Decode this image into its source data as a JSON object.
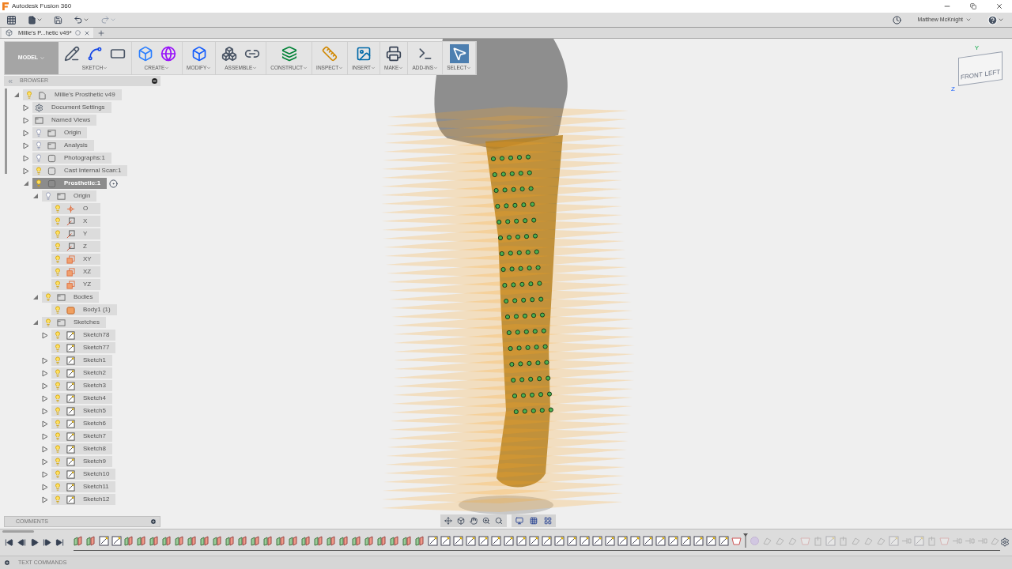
{
  "window": {
    "title": "Autodesk Fusion 360",
    "user": "Matthew McKnight"
  },
  "document_tab": {
    "title": "Millie's P...hetic v49*"
  },
  "ribbon": {
    "workspace": "MODEL",
    "groups": [
      {
        "label": "SKETCH",
        "tools": [
          {
            "kind": "sketch"
          },
          {
            "kind": "arc"
          },
          {
            "kind": "rectangle"
          }
        ],
        "selected": false
      },
      {
        "label": "CREATE",
        "tools": [
          {
            "kind": "box"
          },
          {
            "kind": "form"
          }
        ],
        "selected": false
      },
      {
        "label": "MODIFY",
        "tools": [
          {
            "kind": "press-pull"
          }
        ],
        "selected": false
      },
      {
        "label": "ASSEMBLE",
        "tools": [
          {
            "kind": "component"
          },
          {
            "kind": "joint"
          }
        ],
        "selected": false
      },
      {
        "label": "CONSTRUCT",
        "tools": [
          {
            "kind": "plane"
          }
        ],
        "selected": false
      },
      {
        "label": "INSPECT",
        "tools": [
          {
            "kind": "measure"
          }
        ],
        "selected": false
      },
      {
        "label": "INSERT",
        "tools": [
          {
            "kind": "image"
          }
        ],
        "selected": false
      },
      {
        "label": "MAKE",
        "tools": [
          {
            "kind": "print"
          }
        ],
        "selected": false
      },
      {
        "label": "ADD-INS",
        "tools": [
          {
            "kind": "script"
          }
        ],
        "selected": false
      },
      {
        "label": "SELECT",
        "tools": [
          {
            "kind": "select"
          }
        ],
        "selected": true
      }
    ]
  },
  "browser": {
    "title": "BROWSER",
    "tree": [
      {
        "label": "Millie's Prosthetic v49",
        "kind": "document",
        "visible": true,
        "expanded": true,
        "selected": false,
        "children": [
          {
            "label": "Document Settings",
            "kind": "gear",
            "expanded": false,
            "selected": false
          },
          {
            "label": "Named Views",
            "kind": "folder",
            "expanded": false,
            "selected": false
          },
          {
            "label": "Origin",
            "kind": "folder",
            "visible": false,
            "expanded": false,
            "selected": false
          },
          {
            "label": "Analysis",
            "kind": "folder",
            "visible": false,
            "expanded": false,
            "selected": false
          },
          {
            "label": "Photographs:1",
            "kind": "component",
            "visible": false,
            "expanded": false,
            "selected": false
          },
          {
            "label": "Cast Internal Scan:1",
            "kind": "component",
            "visible": true,
            "expanded": false,
            "selected": false
          },
          {
            "label": "Prosthetic:1",
            "kind": "component",
            "visible": true,
            "expanded": true,
            "selected": true,
            "children": [
              {
                "label": "Origin",
                "kind": "folder",
                "visible": false,
                "expanded": true,
                "selected": false,
                "children": [
                  {
                    "label": "O",
                    "kind": "point",
                    "visible": true,
                    "selected": false
                  },
                  {
                    "label": "X",
                    "kind": "axis",
                    "visible": true,
                    "selected": false
                  },
                  {
                    "label": "Y",
                    "kind": "axis",
                    "visible": true,
                    "selected": false
                  },
                  {
                    "label": "Z",
                    "kind": "axis",
                    "visible": true,
                    "selected": false
                  },
                  {
                    "label": "XY",
                    "kind": "plane",
                    "visible": true,
                    "selected": false
                  },
                  {
                    "label": "XZ",
                    "kind": "plane",
                    "visible": true,
                    "selected": false
                  },
                  {
                    "label": "YZ",
                    "kind": "plane",
                    "visible": true,
                    "selected": false
                  }
                ]
              },
              {
                "label": "Bodies",
                "kind": "folder",
                "visible": true,
                "expanded": true,
                "selected": false,
                "children": [
                  {
                    "label": "Body1 (1)",
                    "kind": "body",
                    "visible": true,
                    "selected": false
                  }
                ]
              },
              {
                "label": "Sketches",
                "kind": "folder",
                "visible": true,
                "expanded": true,
                "selected": false,
                "children": [
                  {
                    "label": "Sketch78",
                    "kind": "sketch",
                    "visible": true,
                    "expanded": false,
                    "selected": false
                  },
                  {
                    "label": "Sketch77",
                    "kind": "sketch",
                    "visible": true,
                    "selected": false
                  },
                  {
                    "label": "Sketch1",
                    "kind": "sketch",
                    "visible": true,
                    "expanded": false,
                    "selected": false
                  },
                  {
                    "label": "Sketch2",
                    "kind": "sketch",
                    "visible": true,
                    "expanded": false,
                    "selected": false
                  },
                  {
                    "label": "Sketch3",
                    "kind": "sketch",
                    "visible": true,
                    "expanded": false,
                    "selected": false
                  },
                  {
                    "label": "Sketch4",
                    "kind": "sketch",
                    "visible": true,
                    "expanded": false,
                    "selected": false
                  },
                  {
                    "label": "Sketch5",
                    "kind": "sketch",
                    "visible": true,
                    "expanded": false,
                    "selected": false
                  },
                  {
                    "label": "Sketch6",
                    "kind": "sketch",
                    "visible": true,
                    "expanded": false,
                    "selected": false
                  },
                  {
                    "label": "Sketch7",
                    "kind": "sketch",
                    "visible": true,
                    "expanded": false,
                    "selected": false
                  },
                  {
                    "label": "Sketch8",
                    "kind": "sketch",
                    "visible": true,
                    "expanded": false,
                    "selected": false
                  },
                  {
                    "label": "Sketch9",
                    "kind": "sketch",
                    "visible": true,
                    "expanded": false,
                    "selected": false
                  },
                  {
                    "label": "Sketch10",
                    "kind": "sketch",
                    "visible": true,
                    "expanded": false,
                    "selected": false
                  },
                  {
                    "label": "Sketch11",
                    "kind": "sketch",
                    "visible": true,
                    "expanded": false,
                    "selected": false
                  },
                  {
                    "label": "Sketch12",
                    "kind": "sketch",
                    "visible": true,
                    "expanded": false,
                    "selected": false
                  }
                ]
              }
            ]
          }
        ]
      }
    ]
  },
  "comments": {
    "title": "COMMENTS"
  },
  "viewcube": {
    "faces": [
      "FRONT",
      "LEFT"
    ],
    "axes": [
      "Y",
      "Z"
    ]
  },
  "timeline": {
    "features": [
      {
        "kind": "plane",
        "active": true
      },
      {
        "kind": "plane",
        "active": true
      },
      {
        "kind": "sketch",
        "active": true
      },
      {
        "kind": "sketch",
        "active": true
      },
      {
        "kind": "plane",
        "active": true
      },
      {
        "kind": "plane",
        "active": true
      },
      {
        "kind": "plane",
        "active": true
      },
      {
        "kind": "plane",
        "active": true
      },
      {
        "kind": "plane",
        "active": true
      },
      {
        "kind": "plane",
        "active": true
      },
      {
        "kind": "plane",
        "active": true
      },
      {
        "kind": "plane",
        "active": true
      },
      {
        "kind": "plane",
        "active": true
      },
      {
        "kind": "plane",
        "active": true
      },
      {
        "kind": "plane",
        "active": true
      },
      {
        "kind": "plane",
        "active": true
      },
      {
        "kind": "plane",
        "active": true
      },
      {
        "kind": "plane",
        "active": true
      },
      {
        "kind": "plane",
        "active": true
      },
      {
        "kind": "plane",
        "active": true
      },
      {
        "kind": "plane",
        "active": true
      },
      {
        "kind": "plane",
        "active": true
      },
      {
        "kind": "plane",
        "active": true
      },
      {
        "kind": "plane",
        "active": true
      },
      {
        "kind": "plane",
        "active": true
      },
      {
        "kind": "plane",
        "active": true
      },
      {
        "kind": "plane",
        "active": true
      },
      {
        "kind": "plane",
        "active": true
      },
      {
        "kind": "sketch",
        "active": true
      },
      {
        "kind": "sketch",
        "active": true
      },
      {
        "kind": "sketch",
        "active": true
      },
      {
        "kind": "sketch",
        "active": true
      },
      {
        "kind": "sketch",
        "active": true
      },
      {
        "kind": "sketch",
        "active": true
      },
      {
        "kind": "sketch",
        "active": true
      },
      {
        "kind": "sketch",
        "active": true
      },
      {
        "kind": "sketch",
        "active": true
      },
      {
        "kind": "sketch",
        "active": true
      },
      {
        "kind": "sketch",
        "active": true
      },
      {
        "kind": "sketch",
        "active": true
      },
      {
        "kind": "sketch",
        "active": true
      },
      {
        "kind": "sketch",
        "active": true
      },
      {
        "kind": "sketch",
        "active": true
      },
      {
        "kind": "sketch",
        "active": true
      },
      {
        "kind": "sketch",
        "active": true
      },
      {
        "kind": "sketch",
        "active": true
      },
      {
        "kind": "sketch",
        "active": true
      },
      {
        "kind": "sketch",
        "active": true
      },
      {
        "kind": "sketch",
        "active": true
      },
      {
        "kind": "sketch",
        "active": true
      },
      {
        "kind": "sketch",
        "active": true
      },
      {
        "kind": "sketch",
        "active": true
      },
      {
        "kind": "body",
        "active": true
      },
      {
        "kind": "form",
        "active": false
      },
      {
        "kind": "move",
        "active": false
      },
      {
        "kind": "move",
        "active": false
      },
      {
        "kind": "move",
        "active": false
      },
      {
        "kind": "body",
        "active": false
      },
      {
        "kind": "extrude",
        "active": false
      },
      {
        "kind": "sketch",
        "active": false
      },
      {
        "kind": "extrude",
        "active": false
      },
      {
        "kind": "move",
        "active": false
      },
      {
        "kind": "move",
        "active": false
      },
      {
        "kind": "move",
        "active": false
      },
      {
        "kind": "sketch",
        "active": false
      },
      {
        "kind": "split",
        "active": false
      },
      {
        "kind": "sketch",
        "active": false
      },
      {
        "kind": "extrude",
        "active": false
      },
      {
        "kind": "body",
        "active": false
      },
      {
        "kind": "split",
        "active": false
      },
      {
        "kind": "split",
        "active": false
      },
      {
        "kind": "split",
        "active": false
      },
      {
        "kind": "move",
        "active": false
      }
    ]
  },
  "text_commands": {
    "title": "TEXT COMMANDS"
  }
}
